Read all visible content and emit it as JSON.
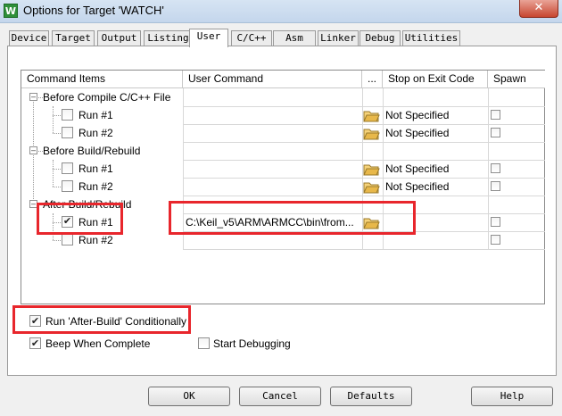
{
  "window": {
    "title": "Options for Target 'WATCH'",
    "app_icon_glyph": "W",
    "close_glyph": "✕"
  },
  "tabs": [
    {
      "label": "Device"
    },
    {
      "label": "Target"
    },
    {
      "label": "Output"
    },
    {
      "label": "Listing"
    },
    {
      "label": "User",
      "active": true
    },
    {
      "label": "C/C++"
    },
    {
      "label": "Asm"
    },
    {
      "label": "Linker"
    },
    {
      "label": "Debug"
    },
    {
      "label": "Utilities"
    }
  ],
  "grid": {
    "headers": {
      "command_items": "Command Items",
      "user_command": "User Command",
      "browse": "...",
      "stop_on_exit": "Stop on Exit Code",
      "spawn": "Spawn"
    },
    "groups": [
      {
        "label": "Before Compile C/C++ File",
        "items": [
          {
            "label": "Run #1",
            "checked": false,
            "command": "",
            "stop": "Not Specified",
            "spawn": false
          },
          {
            "label": "Run #2",
            "checked": false,
            "command": "",
            "stop": "Not Specified",
            "spawn": false
          }
        ]
      },
      {
        "label": "Before Build/Rebuild",
        "items": [
          {
            "label": "Run #1",
            "checked": false,
            "command": "",
            "stop": "Not Specified",
            "spawn": false
          },
          {
            "label": "Run #2",
            "checked": false,
            "command": "",
            "stop": "Not Specified",
            "spawn": false
          }
        ]
      },
      {
        "label": "After Build/Rebuild",
        "items": [
          {
            "label": "Run #1",
            "checked": true,
            "command": "C:\\Keil_v5\\ARM\\ARMCC\\bin\\from...",
            "stop": "",
            "spawn": false
          },
          {
            "label": "Run #2",
            "checked": false,
            "command": "",
            "stop": "",
            "spawn": false
          }
        ]
      }
    ]
  },
  "options": {
    "run_after_build_conditionally": {
      "label": "Run 'After-Build' Conditionally",
      "checked": true
    },
    "beep_when_complete": {
      "label": "Beep When Complete",
      "checked": true
    },
    "start_debugging": {
      "label": "Start Debugging",
      "checked": false
    }
  },
  "buttons": {
    "ok": "OK",
    "cancel": "Cancel",
    "defaults": "Defaults",
    "help": "Help"
  },
  "colors": {
    "highlight_box": "#e8262c",
    "folder": "#e8b84a"
  },
  "icons": {
    "folder": "folder-open-icon",
    "expander": "collapse-minus-icon",
    "checkbox": "checkmark-icon"
  }
}
